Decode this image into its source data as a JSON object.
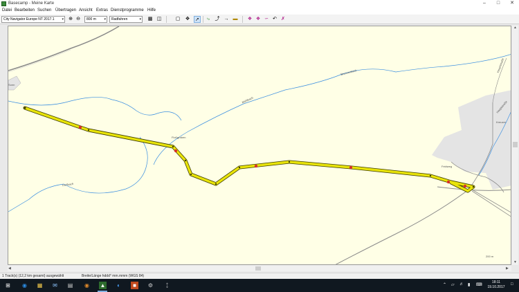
{
  "window": {
    "title": "Basecamp - Meine Karte",
    "minimize_icon": "minimize-icon",
    "maximize_icon": "maximize-icon",
    "close_icon": "close-icon"
  },
  "menu": [
    "Datei",
    "Bearbeiten",
    "Suchen",
    "Übertragen",
    "Ansicht",
    "Extras",
    "Dienstprogramme",
    "Hilfe"
  ],
  "toolbar": {
    "map_product": "City Navigator Europe NT 2017.1",
    "zoom_level": "800 m",
    "activity_profile": "Radfahren",
    "buttons": [
      "zoom-in-icon",
      "zoom-out-icon",
      "gps-device-icon",
      "computer-icon",
      "select-icon",
      "pan-icon",
      "cursor-icon",
      "new-track-icon",
      "new-route-icon",
      "measure-icon",
      "waypoint-icon",
      "ruler-icon",
      "route-tool-icon",
      "dressing-icon",
      "bike-icon",
      "undo-icon",
      "redo-icon"
    ]
  },
  "map": {
    "labels": {
      "lake_label": "Sonn",
      "river_label_1": "Floßgraben",
      "river_label_2": "Mühlbach",
      "river_label_3": "Dorfbach",
      "river_label_4": "Brunnenbach",
      "road_label_1": "Feldweg",
      "road_label_2": "Hauptstraße",
      "town_label": "Kreuzer",
      "scale_label": "200 m",
      "road_label_3": "Hauptstraße"
    },
    "colors": {
      "background": "#ffffe6",
      "route_fill": "#e8e30a",
      "route_stroke": "#3b3b00",
      "waypoint": "#d9302b",
      "river": "#3a8ee0",
      "urban": "#e4e4e4",
      "road": "#8a8a8a"
    }
  },
  "statusbar": {
    "left": "1 Track(s) (12,2 km gesamt) ausgewählt",
    "middle": "Breite/Länge hddd° mm.mmm (WGS 84)"
  },
  "taskbar": {
    "apps": [
      "start-icon",
      "search-icon",
      "task-view-icon",
      "edge-icon",
      "file-explorer-icon",
      "store-icon",
      "mail-icon",
      "basecamp-icon",
      "garmin-express-icon",
      "word-icon",
      "photos-icon",
      "settings-icon",
      "bluetooth-icon"
    ],
    "time": "18:11",
    "date": "19.10.2017"
  }
}
